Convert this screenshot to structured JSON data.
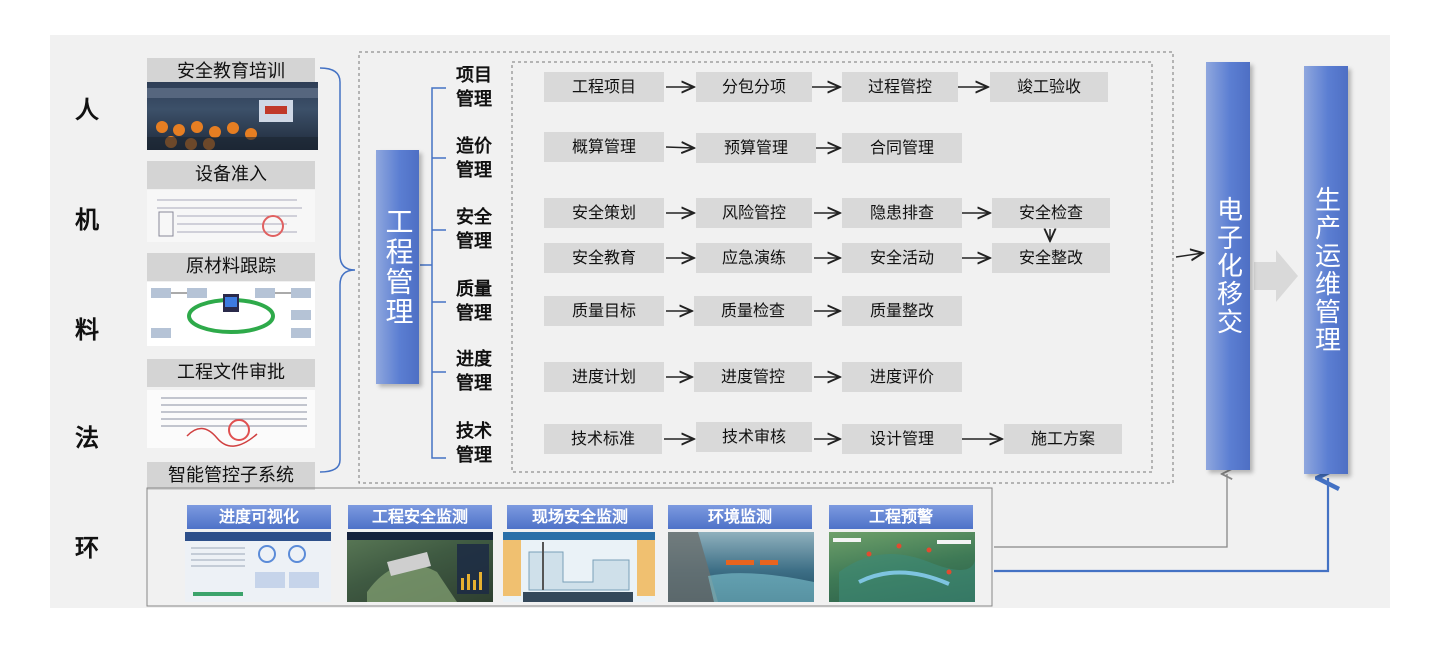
{
  "side_labels": [
    "人",
    "机",
    "料",
    "法",
    "环"
  ],
  "left_panel": {
    "captions": [
      "安全教育培训",
      "设备准入",
      "原材料跟踪",
      "工程文件审批",
      "智能管控子系统"
    ]
  },
  "main_bar": {
    "label": "工程管理"
  },
  "categories": [
    "项目管理",
    "造价管理",
    "安全管理",
    "质量管理",
    "进度管理",
    "技术管理"
  ],
  "rows": {
    "project": [
      "工程项目",
      "分包分项",
      "过程管控",
      "竣工验收"
    ],
    "cost": [
      "概算管理",
      "预算管理",
      "合同管理"
    ],
    "safety_a": [
      "安全策划",
      "风险管控",
      "隐患排查",
      "安全检查"
    ],
    "safety_b": [
      "安全教育",
      "应急演练",
      "安全活动",
      "安全整改"
    ],
    "quality": [
      "质量目标",
      "质量检查",
      "质量整改"
    ],
    "progress": [
      "进度计划",
      "进度管控",
      "进度评价"
    ],
    "tech": [
      "技术标准",
      "技术审核",
      "设计管理",
      "施工方案"
    ]
  },
  "right_bars": {
    "handover": "电子化移交",
    "operation": "生产运维管理"
  },
  "monitors": [
    "进度可视化",
    "工程安全监测",
    "现场安全监测",
    "环境监测",
    "工程预警"
  ],
  "colors": {
    "bar_blue": "#5b7ed2",
    "box_gray": "#d9d9d9",
    "stage_bg": "#f1f1f1",
    "link_blue": "#4472c4"
  }
}
